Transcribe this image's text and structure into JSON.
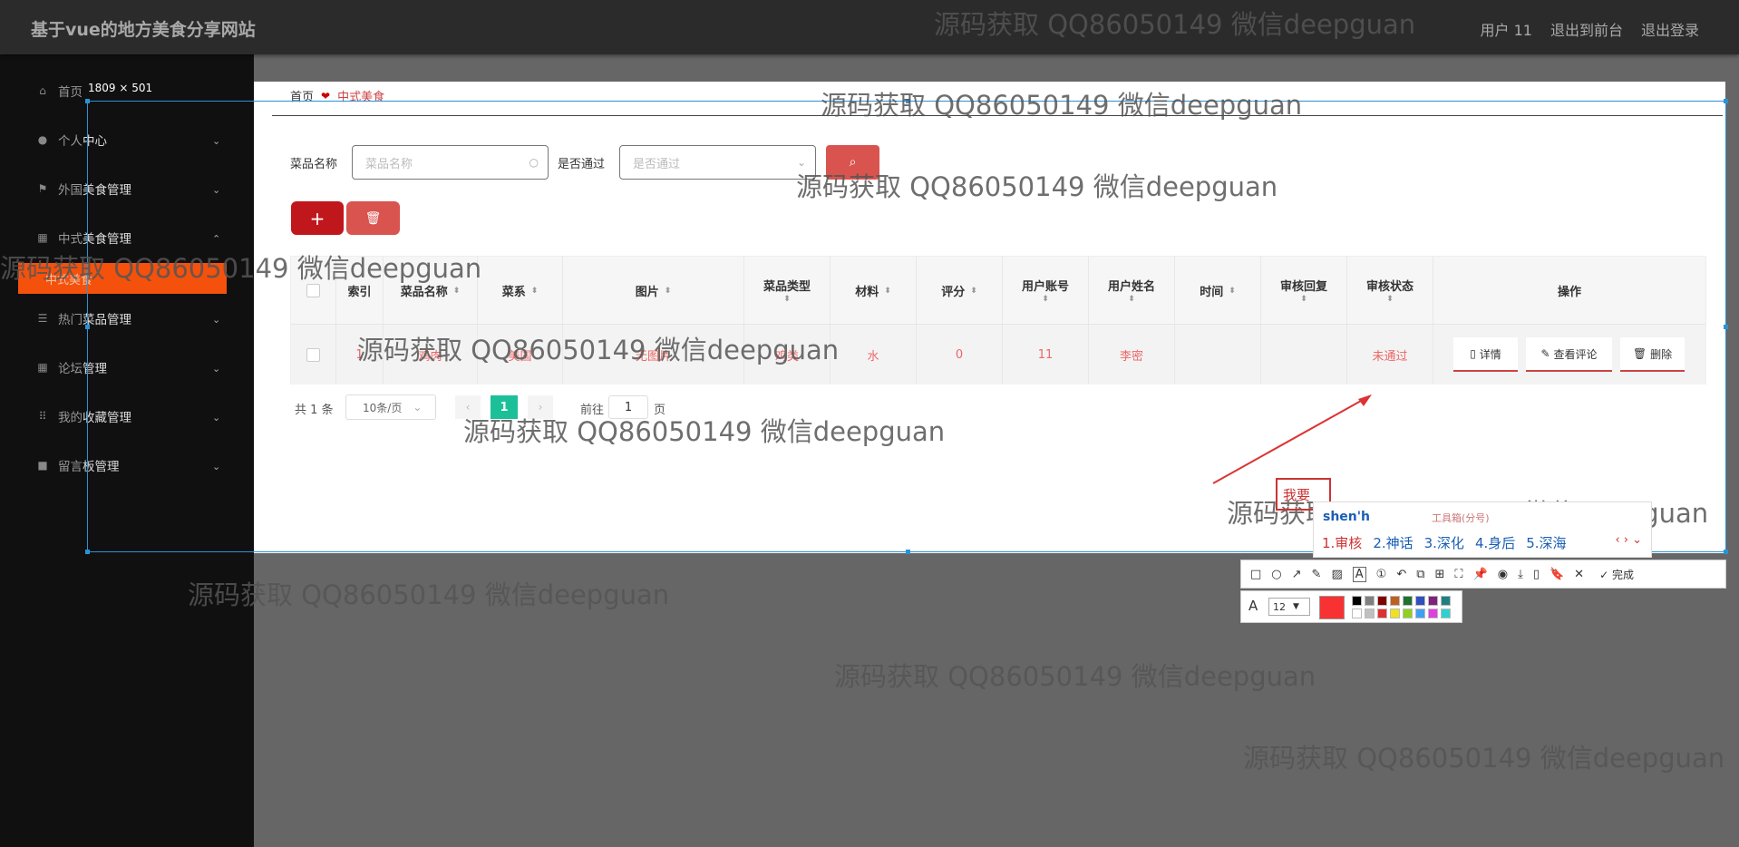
{
  "header": {
    "site_title": "基于vue的地方美食分享网站",
    "user_label": "用户 11",
    "to_front": "退出到前台",
    "logout": "退出登录"
  },
  "sidebar": {
    "items": [
      {
        "label_dim": "首页",
        "label_bright": ""
      },
      {
        "label_dim": "个人",
        "label_bright": "中心"
      },
      {
        "label_dim": "外国",
        "label_bright": "美食管理"
      },
      {
        "label_dim": "中式",
        "label_bright": "美食管理"
      },
      {
        "label_dim": "热门",
        "label_bright": "菜品管理"
      },
      {
        "label_dim": "论坛",
        "label_bright": "管理"
      },
      {
        "label_dim": "我的",
        "label_bright": "收藏管理"
      },
      {
        "label_dim": "留言",
        "label_bright": "板管理"
      }
    ],
    "active_submenu": "中式美食"
  },
  "breadcrumb": {
    "home": "首页",
    "current": "中式美食"
  },
  "search": {
    "name_label": "菜品名称",
    "name_placeholder": "菜品名称",
    "pass_label": "是否通过",
    "pass_placeholder": "是否通过"
  },
  "table": {
    "headers": [
      "索引",
      "菜品名称",
      "菜系",
      "图片",
      "菜品类型",
      "材料",
      "评分",
      "用户账号",
      "用户姓名",
      "时间",
      "审核回复",
      "审核状态",
      "操作"
    ],
    "rows": [
      {
        "index": "1",
        "name": "鸡肉",
        "cuisine": "美国",
        "image": "无图片",
        "type": "鸡类",
        "material": "水",
        "score": "0",
        "account": "11",
        "user_name": "李密",
        "time": "",
        "reply": "",
        "status": "未通过"
      }
    ],
    "actions": {
      "detail": "详情",
      "comments": "查看评论",
      "delete": "删除"
    }
  },
  "pagination": {
    "total": "共 1 条",
    "page_size": "10条/页",
    "current_page": "1",
    "goto_prefix": "前往",
    "goto_value": "1",
    "goto_suffix": "页"
  },
  "screenshot_tool": {
    "size_label": "1809 × 501",
    "annotation_text": "我要",
    "ime_input": "shen'h",
    "ime_toolbox": "工具箱(分号)",
    "ime_candidates": [
      "1.审核",
      "2.神话",
      "3.深化",
      "4.身后",
      "5.深海"
    ],
    "done_label": "完成",
    "font_size": "12",
    "current_color": "#f83232"
  },
  "watermark": "源码获取 QQ86050149 微信deepguan"
}
